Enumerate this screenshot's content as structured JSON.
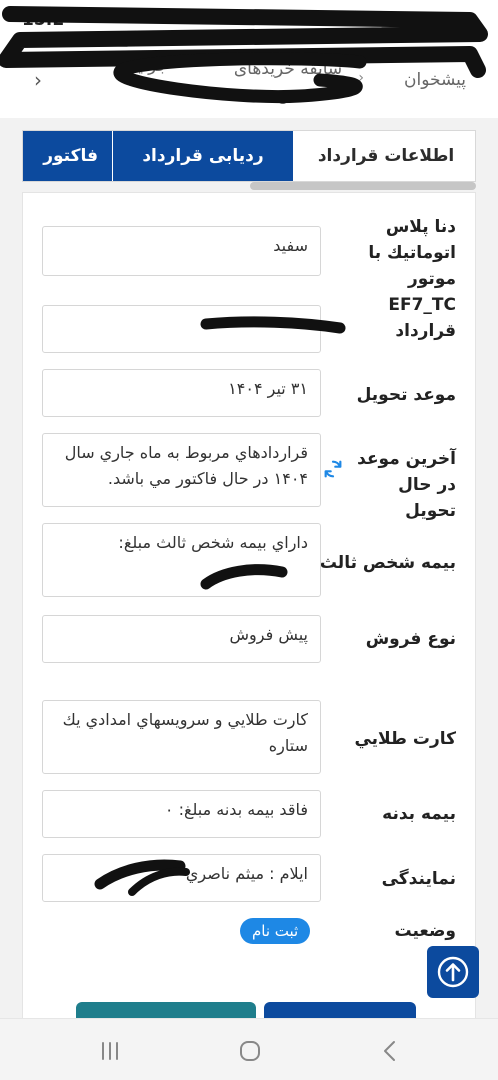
{
  "status_bar": {
    "time": "15:2"
  },
  "breadcrumb": {
    "items": [
      "پیشخوان",
      "سابقه خریدهای من",
      "جزئیات"
    ],
    "back_icon": "chevron-left-icon"
  },
  "tabs": [
    {
      "label": "اطلاعات قرارداد",
      "active": true
    },
    {
      "label": "ردیابی قرارداد",
      "active": false
    },
    {
      "label": "فاکتور",
      "active": false
    }
  ],
  "details": {
    "product": {
      "label": "دنا پلاس اتوماتيك با موتور EF7_TC",
      "value": "سفيد"
    },
    "contract": {
      "label": "قرارداد",
      "value": ""
    },
    "delivery_date": {
      "label": "موعد تحويل",
      "value": "۳۱ تير ۱۴۰۴"
    },
    "last_delivery_date": {
      "label": "آخرين موعد در حال تحويل",
      "value": "قراردادهاي مربوط به ماه جاري سال ۱۴۰۴ در حال فاکتور مي باشد."
    },
    "third_party_insurance": {
      "label": "بيمه شخص ثالث",
      "value": "داراي بيمه شخص ثالث مبلغ:"
    },
    "sale_type": {
      "label": "نوع فروش",
      "value": "پيش فروش"
    },
    "golden_card": {
      "label": "کارت طلايي",
      "value": "کارت طلايي و سرويسهاي امدادي يك ستاره"
    },
    "body_insurance": {
      "label": "بيمه بدنه",
      "value": "فاقد بيمه بدنه مبلغ: ۰"
    },
    "agency": {
      "label": "نمايندگی",
      "value": "ايلام : ميثم ناصري"
    },
    "status": {
      "label": "وضعيت",
      "value": "ثبت نام"
    }
  },
  "colors": {
    "primary": "#0c4a9e",
    "badge": "#1e88e5",
    "teal": "#1f7e8c"
  }
}
